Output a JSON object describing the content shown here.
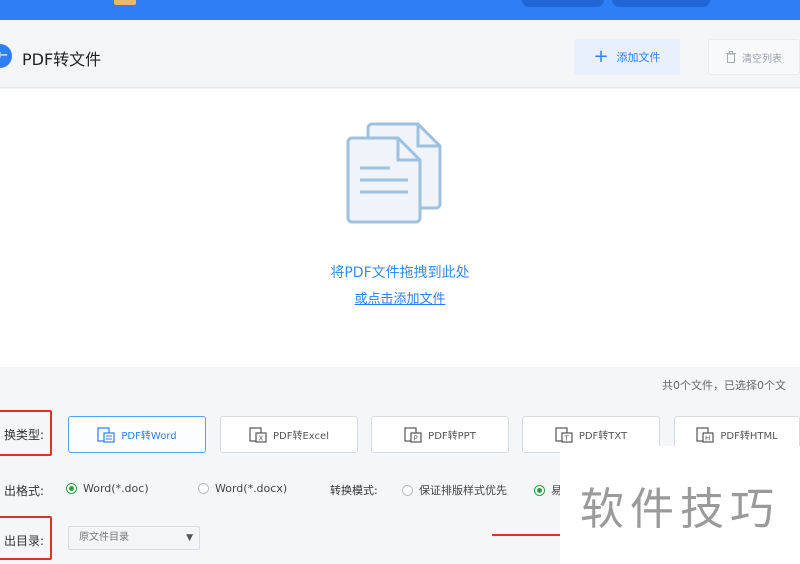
{
  "header": {
    "back_icon": "back-arrow-icon",
    "title": "PDF转文件",
    "add_file_label": "添加文件",
    "clear_list_label": "清空列表"
  },
  "dropzone": {
    "icon": "documents-icon",
    "drag_text": "将PDF文件拖拽到此处",
    "click_text": "或点击添加文件"
  },
  "status_text": "共0个文件，已选择0个文",
  "convert_type": {
    "label": "换类型:",
    "options": [
      {
        "label": "PDF转Word",
        "icon": "word-file-icon",
        "active": true
      },
      {
        "label": "PDF转Excel",
        "icon": "excel-file-icon",
        "active": false
      },
      {
        "label": "PDF转PPT",
        "icon": "ppt-file-icon",
        "active": false
      },
      {
        "label": "PDF转TXT",
        "icon": "txt-file-icon",
        "active": false
      },
      {
        "label": "PDF转HTML",
        "icon": "html-file-icon",
        "active": false
      }
    ]
  },
  "output_format": {
    "label": "出格式:",
    "options": [
      {
        "label": "Word(*.doc)",
        "selected": true
      },
      {
        "label": "Word(*.docx)",
        "selected": false
      }
    ]
  },
  "convert_mode": {
    "label": "转换模式:",
    "options": [
      {
        "label": "保证排版样式优先",
        "selected": false
      },
      {
        "label": "易",
        "selected": true
      }
    ]
  },
  "output_dir": {
    "label": "出目录:",
    "value": "原文件目录"
  },
  "watermark": "软件技巧",
  "colors": {
    "accent": "#2f7ef5",
    "highlight_box": "#d9342b",
    "radio_on": "#2a9d3f"
  }
}
